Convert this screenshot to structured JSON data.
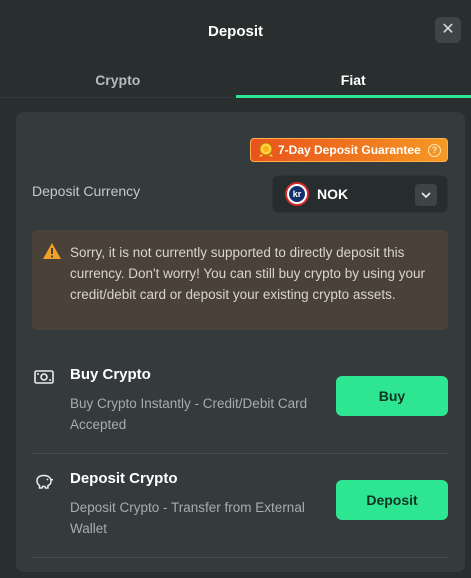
{
  "header": {
    "title": "Deposit",
    "close_icon": "close-icon"
  },
  "tabs": [
    {
      "label": "Crypto",
      "active": false
    },
    {
      "label": "Fiat",
      "active": true
    }
  ],
  "guarantee": {
    "label": "7-Day Deposit Guarantee",
    "help": "?"
  },
  "currency": {
    "label": "Deposit Currency",
    "selected": "NOK",
    "flag_text": "kr"
  },
  "warning": {
    "text": "Sorry, it is not currently supported to directly deposit this currency. Don't worry! You can still buy crypto by using your credit/debit card or deposit your existing crypto assets."
  },
  "options": [
    {
      "title": "Buy Crypto",
      "description": "Buy Crypto Instantly - Credit/Debit Card Accepted",
      "button": "Buy",
      "icon": "cash-icon"
    },
    {
      "title": "Deposit Crypto",
      "description": "Deposit Crypto - Transfer from External Wallet",
      "button": "Deposit",
      "icon": "piggy-bank-icon"
    }
  ],
  "colors": {
    "accent": "#2ee592",
    "background": "#292e2f",
    "panel": "#353b3c",
    "warning_bg": "#4a4139",
    "warning_icon": "#f0a12a"
  }
}
